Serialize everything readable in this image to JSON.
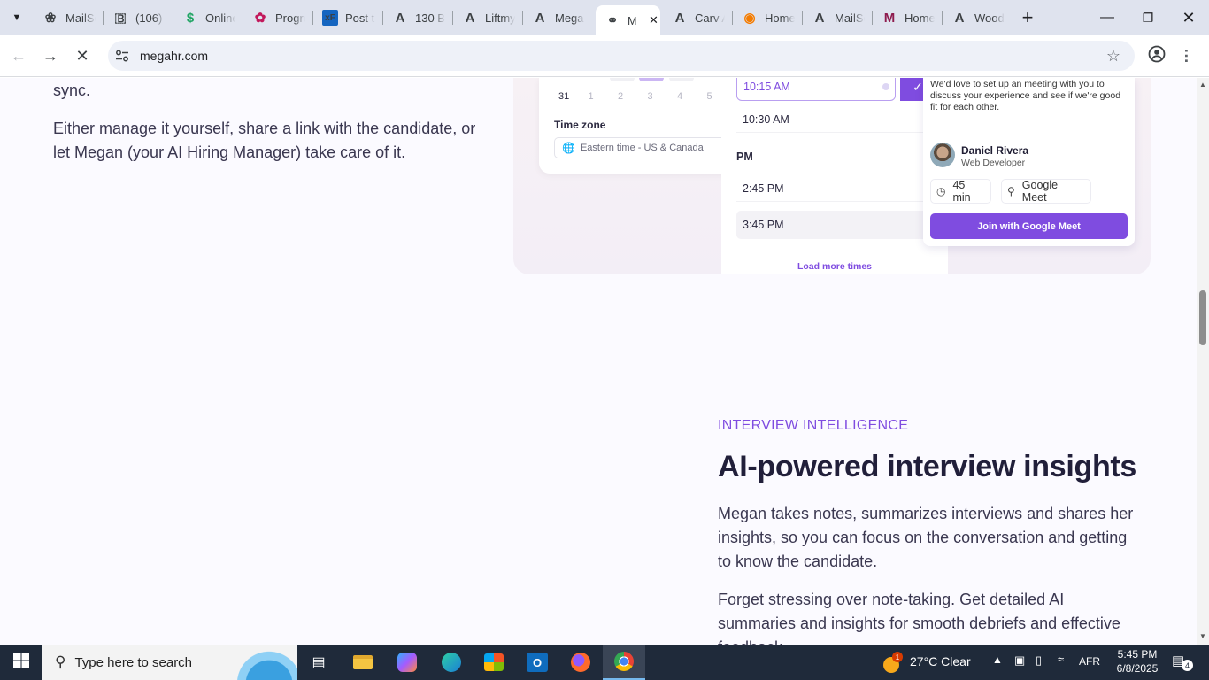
{
  "tabs": [
    {
      "title": "MailSc",
      "icon": "openai-icon"
    },
    {
      "title": "(106)",
      "icon": "blog-icon"
    },
    {
      "title": "Online",
      "icon": "dollar-icon"
    },
    {
      "title": "Progre",
      "icon": "progress-icon"
    },
    {
      "title": "Post t",
      "icon": "xf-icon"
    },
    {
      "title": "130 B",
      "icon": "a-logo-icon"
    },
    {
      "title": "Liftmy",
      "icon": "a-logo-icon"
    },
    {
      "title": "Mega",
      "icon": "a-logo-icon"
    },
    {
      "title": "M",
      "icon": "megahr-icon"
    },
    {
      "title": "Carv A",
      "icon": "a-logo-icon"
    },
    {
      "title": "Home",
      "icon": "home-orange-icon"
    },
    {
      "title": "MailSc",
      "icon": "a-logo-icon"
    },
    {
      "title": "Home",
      "icon": "mail-icon"
    },
    {
      "title": "Wood",
      "icon": "a-logo-icon"
    }
  ],
  "browser": {
    "url": "megahr.com"
  },
  "page": {
    "left_partial": "sync.",
    "left_para": "Either manage it yourself, share a link with the candidate, or let Megan (your AI Hiring Manager) take care of it.",
    "calendar": {
      "dates": [
        "31",
        "1",
        "2",
        "3",
        "4",
        "5"
      ],
      "timezone_label": "Time zone",
      "timezone_value": "Eastern time - US & Canada"
    },
    "times": {
      "selected": "10:15 AM",
      "slot2": "10:30 AM",
      "pm_label": "PM",
      "slot3": "2:45 PM",
      "slot4": "3:45 PM",
      "load_more": "Load more times"
    },
    "invite": {
      "message": "We'd love to set up an meeting with you to discuss your experience and see if we're good fit for each other.",
      "name": "Daniel Rivera",
      "role": "Web Developer",
      "duration": "45 min",
      "location": "Google Meet",
      "join_button": "Join with Google Meet"
    },
    "section": {
      "eyebrow": "INTERVIEW INTELLIGENCE",
      "heading": "AI-powered interview insights",
      "para1": "Megan takes notes, summarizes interviews and shares her insights, so you can focus on the conversation and getting to know the candidate.",
      "para2": "Forget stressing over note-taking. Get detailed AI summaries and insights for smooth debriefs and effective feedback."
    }
  },
  "taskbar": {
    "search_placeholder": "Type here to search",
    "weather": "27°C  Clear",
    "lang": "AFR",
    "time": "5:45 PM",
    "date": "6/8/2025",
    "notif_count": "4"
  },
  "colors": {
    "accent": "#7f4ce0",
    "heading": "#211f3a"
  }
}
